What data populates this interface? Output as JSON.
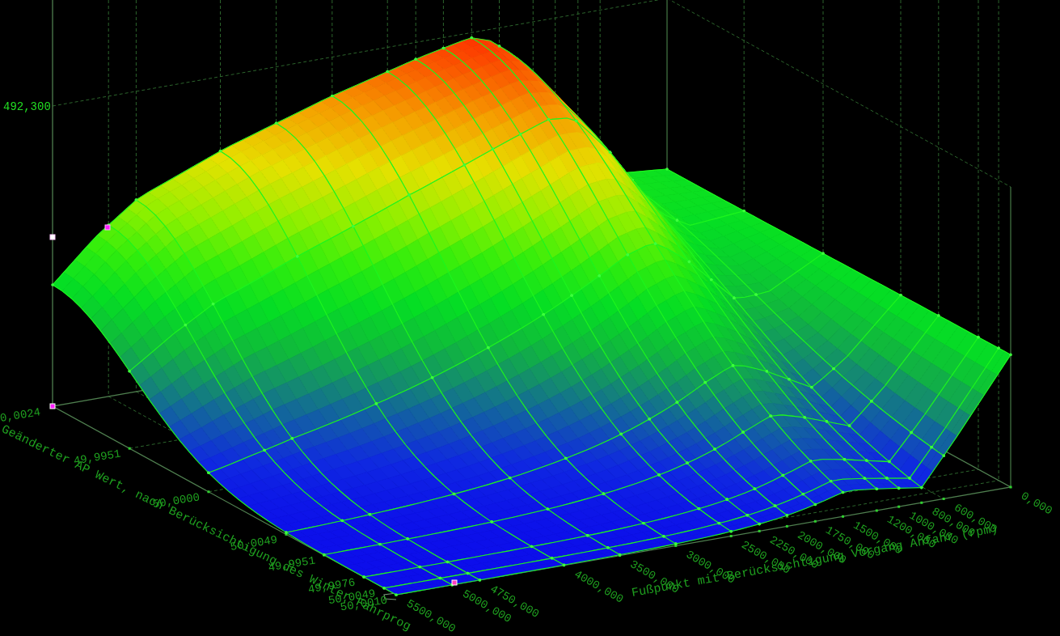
{
  "plot": {
    "vertical_axis": {
      "ticks": [
        "492,300"
      ]
    },
    "left_axis": {
      "title": "Geänderter AP Wert, nach Berücksichtigung des Winter Fahrprog",
      "ticks": [
        "0,0024",
        "49,9951",
        "50,0000",
        "50,0049",
        "49,9951",
        "49,9976",
        "50,0049",
        "50,0010"
      ]
    },
    "bottom_axis": {
      "title": "Fußpunkt mit Berücksichtigung Vorgang Anfahr (rpm)",
      "ticks": [
        "5500,000",
        "5000,000",
        "4750,000",
        "4000,000",
        "3500,000",
        "3000,000",
        "2500,000",
        "2250,000",
        "2000,000",
        "1750,000",
        "1500,000",
        "1200,000",
        "1000,000",
        "800,000",
        "600,000",
        "0,000"
      ]
    }
  }
}
